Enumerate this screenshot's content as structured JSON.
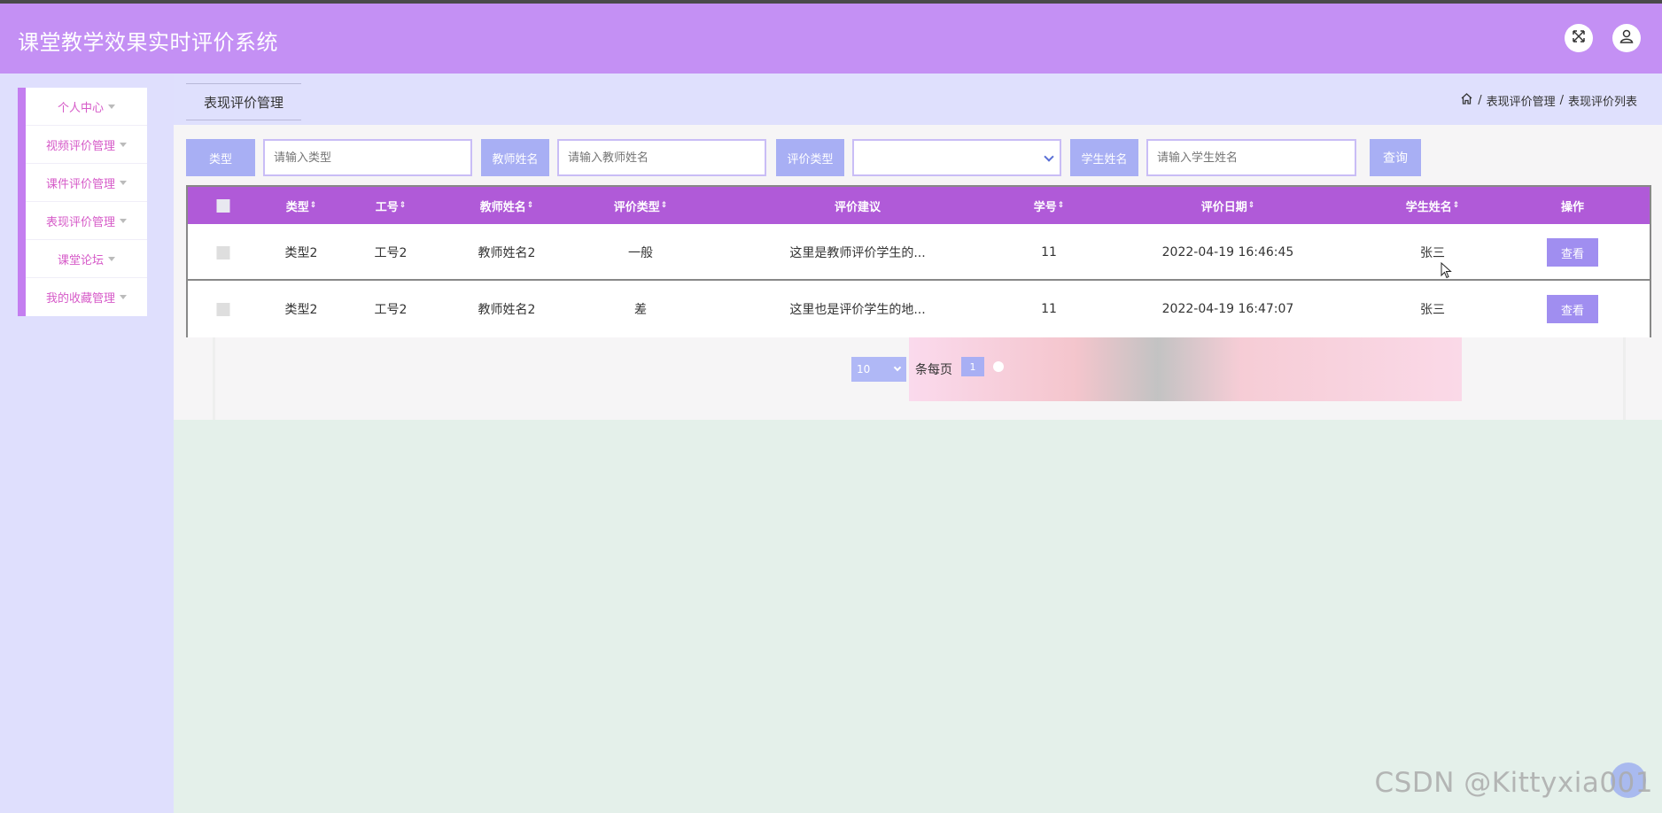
{
  "header": {
    "title": "课堂教学效果实时评价系统",
    "icons": [
      "fullscreen-icon",
      "user-icon"
    ]
  },
  "sidebar": {
    "items": [
      {
        "label": "个人中心"
      },
      {
        "label": "视频评价管理"
      },
      {
        "label": "课件评价管理"
      },
      {
        "label": "表现评价管理"
      },
      {
        "label": "课堂论坛"
      },
      {
        "label": "我的收藏管理"
      }
    ]
  },
  "page": {
    "tab_label": "表现评价管理",
    "breadcrumb": {
      "level1": "表现评价管理",
      "level2": "表现评价列表",
      "sep": "/"
    }
  },
  "search": {
    "type_label": "类型",
    "type_placeholder": "请输入类型",
    "teacher_label": "教师姓名",
    "teacher_placeholder": "请输入教师姓名",
    "eval_type_label": "评价类型",
    "eval_type_value": "",
    "student_label": "学生姓名",
    "student_placeholder": "请输入学生姓名",
    "query_button": "查询"
  },
  "table": {
    "columns": [
      "类型",
      "工号",
      "教师姓名",
      "评价类型",
      "评价建议",
      "学号",
      "评价日期",
      "学生姓名",
      "操作"
    ],
    "sortable": [
      true,
      true,
      true,
      true,
      false,
      true,
      true,
      true,
      false
    ],
    "sort_glyph": "⇕",
    "rows": [
      {
        "type": "类型2",
        "job_no": "工号2",
        "teacher": "教师姓名2",
        "eval_type": "一般",
        "suggestion": "这里是教师评价学生的...",
        "student_no": "11",
        "date": "2022-04-19 16:46:45",
        "student": "张三",
        "action": "查看"
      },
      {
        "type": "类型2",
        "job_no": "工号2",
        "teacher": "教师姓名2",
        "eval_type": "差",
        "suggestion": "这里也是评价学生的地...",
        "student_no": "11",
        "date": "2022-04-19 16:47:07",
        "student": "张三",
        "action": "查看"
      }
    ]
  },
  "pagination": {
    "page_size": "10",
    "per_page_text": "条每页",
    "current_page": "1"
  },
  "watermark": "CSDN @Kittyxia001",
  "colors": {
    "header": "#c490f4",
    "table_header": "#b05ad8",
    "button": "#a8aff4",
    "sidebar_text": "#d65ac8"
  }
}
